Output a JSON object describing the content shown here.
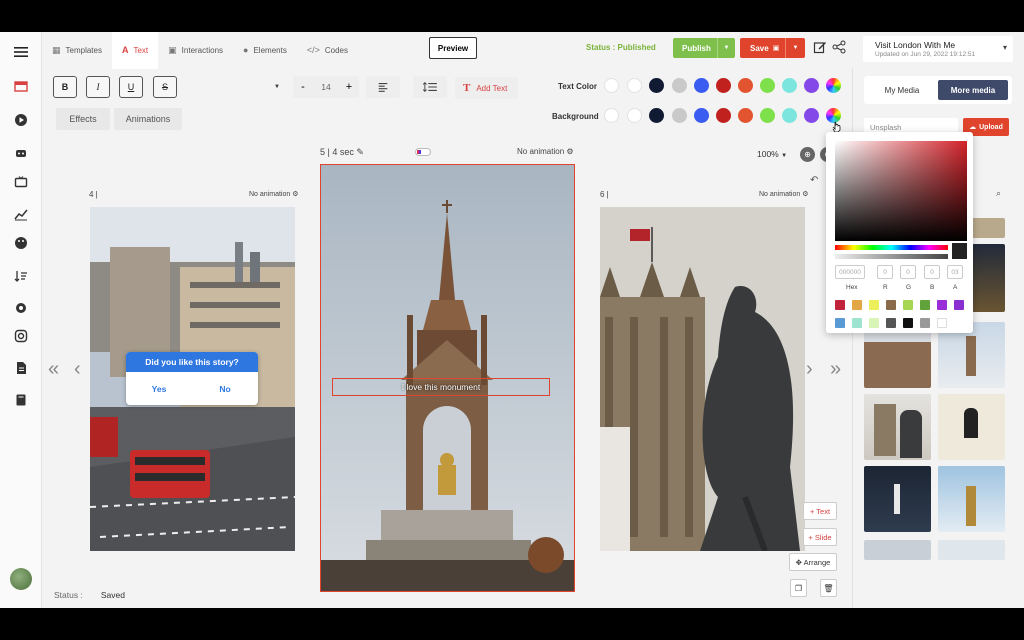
{
  "menu": {
    "items": [
      {
        "label": "Templates",
        "glyph": "▦",
        "icon": "templates-icon"
      },
      {
        "label": "Text",
        "glyph": "A",
        "icon": "text-icon"
      },
      {
        "label": "Interactions",
        "glyph": "▣",
        "icon": "interactions-icon"
      },
      {
        "label": "Elements",
        "glyph": "●",
        "icon": "elements-icon"
      },
      {
        "label": "Codes",
        "glyph": "</>",
        "icon": "codes-icon"
      }
    ],
    "preview": "Preview",
    "status": "Status : Published",
    "publish": "Publish",
    "save": "Save",
    "story_title": "Visit London With Me",
    "story_updated": "Updated on Jun 29, 2022 19:12:51"
  },
  "toolbar": {
    "bold": "B",
    "italic": "I",
    "underline": "U",
    "strike": "S",
    "font_size": "14",
    "minus": "-",
    "plus": "+",
    "add_text": "Add Text",
    "add_text_glyph": "T",
    "effects": "Effects",
    "animations": "Animations",
    "text_color_label": "Text Color",
    "background_label": "Background",
    "swatches": [
      "#ffffff",
      "#ffffff",
      "#111a33",
      "#c9c9c9",
      "#3b5cf0",
      "#c0211e",
      "#e2532f",
      "#7ee04a",
      "#7ce6de",
      "#8448e8"
    ]
  },
  "canvas": {
    "prev_slide_num": "4 |",
    "cur_slide_info": "5 |  4 sec ✎",
    "next_slide_num": "6 |",
    "no_anim": "No animation ⚙",
    "zoom": "100%",
    "overlay_text": "I love this monument",
    "poll_question": "Did you like this story?",
    "poll_yes": "Yes",
    "poll_no": "No",
    "btn_text": "+ Text",
    "btn_slide": "+ Slide",
    "btn_arrange": "✥ Arrange",
    "status_label": "Status :",
    "status_value": "Saved"
  },
  "media": {
    "tab_my": "My Media",
    "tab_more": "More media",
    "source": "Unsplash",
    "upload": "Upload"
  },
  "picker": {
    "hex_value": "000000",
    "r": "0",
    "g": "0",
    "b": "0",
    "a": "03",
    "labels": [
      "Hex",
      "R",
      "G",
      "B",
      "A"
    ],
    "swatches_row1": [
      "#c0233a",
      "#e2a645",
      "#ecef59",
      "#8a6a4a",
      "#a6d652",
      "#5fa33a",
      "#9a2fd8",
      "#8a2ed0"
    ],
    "swatches_row2": [
      "#5b9bd5",
      "#9fe3d1",
      "#d8f4b6",
      "#555555",
      "#111111",
      "#999999",
      "#ffffff"
    ]
  }
}
